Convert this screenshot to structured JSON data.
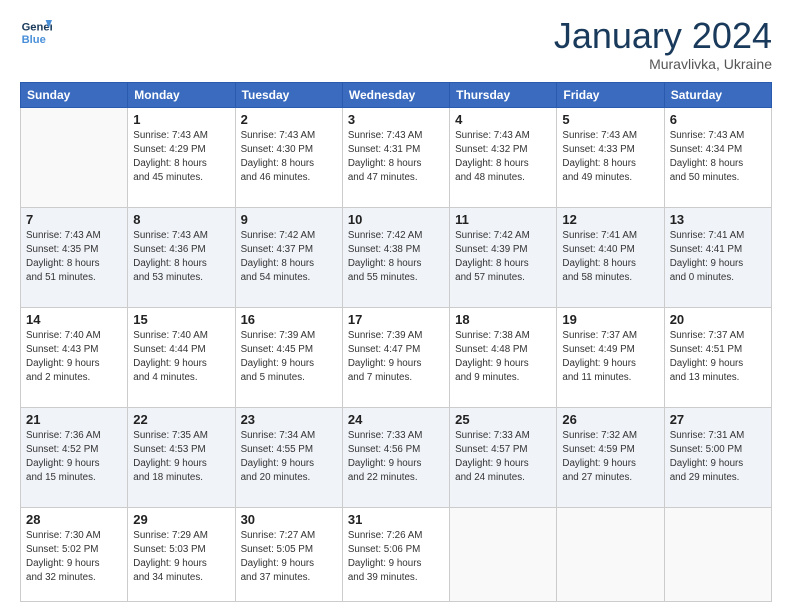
{
  "header": {
    "logo": {
      "line1": "General",
      "line2": "Blue"
    },
    "title": "January 2024",
    "location": "Muravlivka, Ukraine"
  },
  "weekdays": [
    "Sunday",
    "Monday",
    "Tuesday",
    "Wednesday",
    "Thursday",
    "Friday",
    "Saturday"
  ],
  "weeks": [
    [
      {
        "day": "",
        "info": ""
      },
      {
        "day": "1",
        "info": "Sunrise: 7:43 AM\nSunset: 4:29 PM\nDaylight: 8 hours\nand 45 minutes."
      },
      {
        "day": "2",
        "info": "Sunrise: 7:43 AM\nSunset: 4:30 PM\nDaylight: 8 hours\nand 46 minutes."
      },
      {
        "day": "3",
        "info": "Sunrise: 7:43 AM\nSunset: 4:31 PM\nDaylight: 8 hours\nand 47 minutes."
      },
      {
        "day": "4",
        "info": "Sunrise: 7:43 AM\nSunset: 4:32 PM\nDaylight: 8 hours\nand 48 minutes."
      },
      {
        "day": "5",
        "info": "Sunrise: 7:43 AM\nSunset: 4:33 PM\nDaylight: 8 hours\nand 49 minutes."
      },
      {
        "day": "6",
        "info": "Sunrise: 7:43 AM\nSunset: 4:34 PM\nDaylight: 8 hours\nand 50 minutes."
      }
    ],
    [
      {
        "day": "7",
        "info": "Sunrise: 7:43 AM\nSunset: 4:35 PM\nDaylight: 8 hours\nand 51 minutes."
      },
      {
        "day": "8",
        "info": "Sunrise: 7:43 AM\nSunset: 4:36 PM\nDaylight: 8 hours\nand 53 minutes."
      },
      {
        "day": "9",
        "info": "Sunrise: 7:42 AM\nSunset: 4:37 PM\nDaylight: 8 hours\nand 54 minutes."
      },
      {
        "day": "10",
        "info": "Sunrise: 7:42 AM\nSunset: 4:38 PM\nDaylight: 8 hours\nand 55 minutes."
      },
      {
        "day": "11",
        "info": "Sunrise: 7:42 AM\nSunset: 4:39 PM\nDaylight: 8 hours\nand 57 minutes."
      },
      {
        "day": "12",
        "info": "Sunrise: 7:41 AM\nSunset: 4:40 PM\nDaylight: 8 hours\nand 58 minutes."
      },
      {
        "day": "13",
        "info": "Sunrise: 7:41 AM\nSunset: 4:41 PM\nDaylight: 9 hours\nand 0 minutes."
      }
    ],
    [
      {
        "day": "14",
        "info": "Sunrise: 7:40 AM\nSunset: 4:43 PM\nDaylight: 9 hours\nand 2 minutes."
      },
      {
        "day": "15",
        "info": "Sunrise: 7:40 AM\nSunset: 4:44 PM\nDaylight: 9 hours\nand 4 minutes."
      },
      {
        "day": "16",
        "info": "Sunrise: 7:39 AM\nSunset: 4:45 PM\nDaylight: 9 hours\nand 5 minutes."
      },
      {
        "day": "17",
        "info": "Sunrise: 7:39 AM\nSunset: 4:47 PM\nDaylight: 9 hours\nand 7 minutes."
      },
      {
        "day": "18",
        "info": "Sunrise: 7:38 AM\nSunset: 4:48 PM\nDaylight: 9 hours\nand 9 minutes."
      },
      {
        "day": "19",
        "info": "Sunrise: 7:37 AM\nSunset: 4:49 PM\nDaylight: 9 hours\nand 11 minutes."
      },
      {
        "day": "20",
        "info": "Sunrise: 7:37 AM\nSunset: 4:51 PM\nDaylight: 9 hours\nand 13 minutes."
      }
    ],
    [
      {
        "day": "21",
        "info": "Sunrise: 7:36 AM\nSunset: 4:52 PM\nDaylight: 9 hours\nand 15 minutes."
      },
      {
        "day": "22",
        "info": "Sunrise: 7:35 AM\nSunset: 4:53 PM\nDaylight: 9 hours\nand 18 minutes."
      },
      {
        "day": "23",
        "info": "Sunrise: 7:34 AM\nSunset: 4:55 PM\nDaylight: 9 hours\nand 20 minutes."
      },
      {
        "day": "24",
        "info": "Sunrise: 7:33 AM\nSunset: 4:56 PM\nDaylight: 9 hours\nand 22 minutes."
      },
      {
        "day": "25",
        "info": "Sunrise: 7:33 AM\nSunset: 4:57 PM\nDaylight: 9 hours\nand 24 minutes."
      },
      {
        "day": "26",
        "info": "Sunrise: 7:32 AM\nSunset: 4:59 PM\nDaylight: 9 hours\nand 27 minutes."
      },
      {
        "day": "27",
        "info": "Sunrise: 7:31 AM\nSunset: 5:00 PM\nDaylight: 9 hours\nand 29 minutes."
      }
    ],
    [
      {
        "day": "28",
        "info": "Sunrise: 7:30 AM\nSunset: 5:02 PM\nDaylight: 9 hours\nand 32 minutes."
      },
      {
        "day": "29",
        "info": "Sunrise: 7:29 AM\nSunset: 5:03 PM\nDaylight: 9 hours\nand 34 minutes."
      },
      {
        "day": "30",
        "info": "Sunrise: 7:27 AM\nSunset: 5:05 PM\nDaylight: 9 hours\nand 37 minutes."
      },
      {
        "day": "31",
        "info": "Sunrise: 7:26 AM\nSunset: 5:06 PM\nDaylight: 9 hours\nand 39 minutes."
      },
      {
        "day": "",
        "info": ""
      },
      {
        "day": "",
        "info": ""
      },
      {
        "day": "",
        "info": ""
      }
    ]
  ]
}
